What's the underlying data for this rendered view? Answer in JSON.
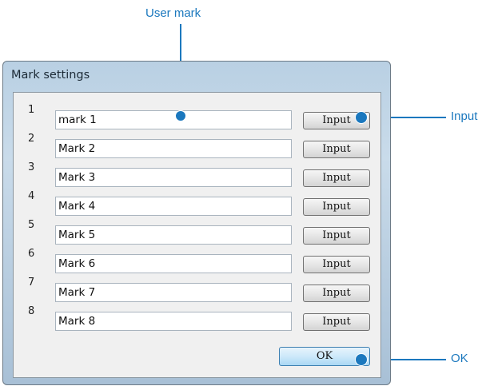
{
  "callouts": {
    "user_mark": "User mark",
    "input": "Input",
    "ok": "OK"
  },
  "dialog": {
    "title": "Mark settings",
    "rows": [
      {
        "num": "1",
        "value": "mark 1",
        "button": "Input"
      },
      {
        "num": "2",
        "value": "Mark 2",
        "button": "Input"
      },
      {
        "num": "3",
        "value": "Mark 3",
        "button": "Input"
      },
      {
        "num": "4",
        "value": "Mark 4",
        "button": "Input"
      },
      {
        "num": "5",
        "value": "Mark 5",
        "button": "Input"
      },
      {
        "num": "6",
        "value": "Mark 6",
        "button": "Input"
      },
      {
        "num": "7",
        "value": "Mark 7",
        "button": "Input"
      },
      {
        "num": "8",
        "value": "Mark 8",
        "button": "Input"
      }
    ],
    "ok_label": "OK"
  },
  "colors": {
    "callout_blue": "#1b78be"
  }
}
